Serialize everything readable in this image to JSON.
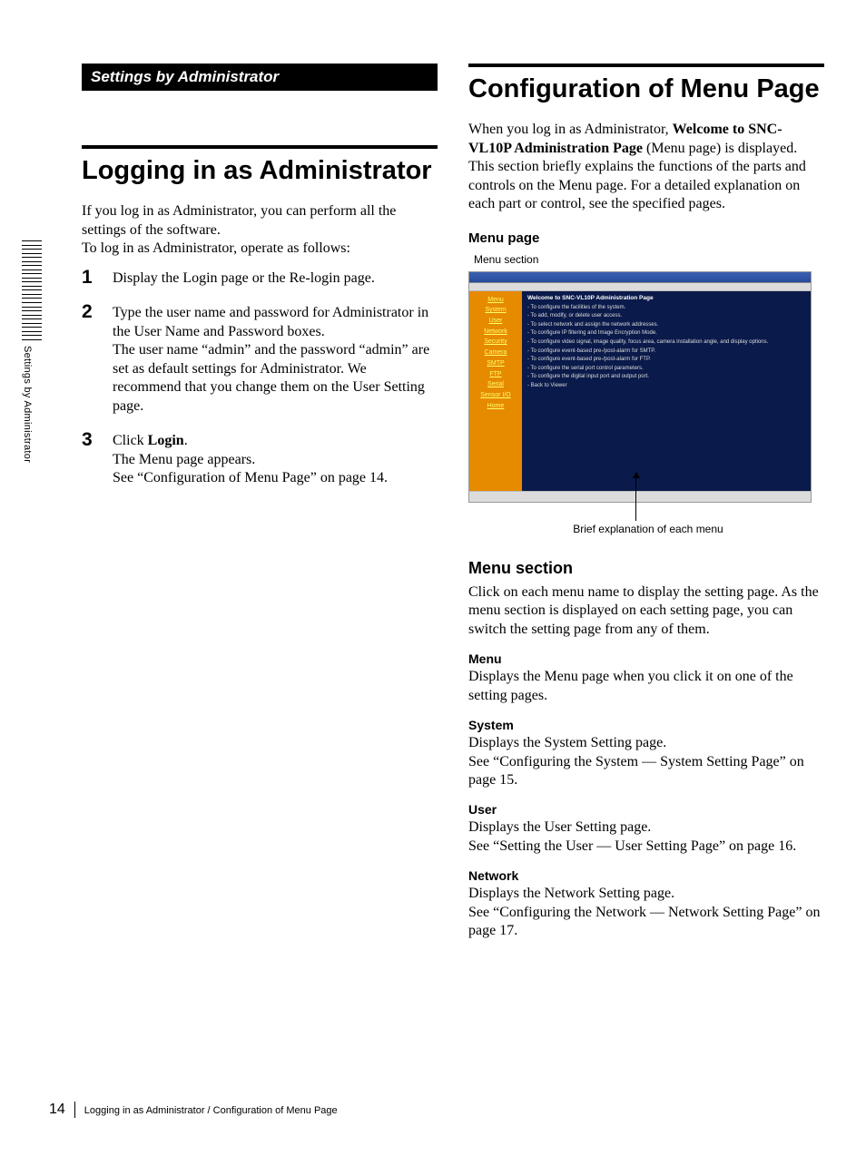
{
  "side_label": "Settings by Administrator",
  "banner": "Settings by Administrator",
  "left": {
    "h1": "Logging in as Administrator",
    "intro1": "If you log in as Administrator, you can perform all the settings of the software.",
    "intro2": "To log in as Administrator, operate as follows:",
    "step1": "Display the Login page or the Re-login page.",
    "step2a": "Type the user name and password for Administrator in the User Name and Password boxes.",
    "step2b": "The user name “admin”  and the password “admin” are set as default settings for Administrator.  We recommend that you change them on the User Setting page.",
    "step3_pre": "Click ",
    "step3_bold": "Login",
    "step3_post": ".",
    "step3b": "The Menu page appears.",
    "step3c": "See “Configuration of Menu Page” on page 14."
  },
  "right": {
    "h1": "Configuration of Menu Page",
    "p1_pre": "When you log in as Administrator, ",
    "p1_bold": "Welcome to SNC-VL10P Administration Page",
    "p1_post": " (Menu page) is displayed.",
    "p2": "This section briefly explains the functions of the parts and controls on the Menu page.  For a detailed explanation on each part or control, see the specified pages.",
    "h_menu_page": "Menu page",
    "cap_top": "Menu section",
    "cap_bottom": "Brief explanation of each menu",
    "shot": {
      "header": "Welcome to SNC-VL10P Administration Page",
      "items": [
        "Menu",
        "System",
        "User",
        "Network",
        "Security",
        "Camera",
        "SMTP",
        "FTP",
        "Serial",
        "Sensor I/O",
        "Home"
      ],
      "descs": [
        "- To configure the facilities of the system.",
        "- To add, modify, or delete user access.",
        "- To select network and assign the network addresses.",
        "- To configure IP filtering and Image Encryption Mode.",
        "- To configure video signal, image quality, focus area, camera installation angle, and display options.",
        "- To configure event-based pre-/post-alarm for SMTP.",
        "- To configure event-based pre-/post-alarm for FTP.",
        "- To configure the serial port control parameters.",
        "- To configure the digital input port and output port.",
        "- Back to Viewer"
      ]
    },
    "h_menu_section": "Menu section",
    "ms_p": "Click on each menu name to display the setting page. As the menu section is displayed on each setting page, you can switch the setting page from any of them.",
    "item_menu_h": "Menu",
    "item_menu_p": "Displays the Menu page when you click it on one of the setting pages.",
    "item_system_h": "System",
    "item_system_p1": "Displays the System Setting page.",
    "item_system_p2": "See “Configuring the System — System Setting Page” on page 15.",
    "item_user_h": "User",
    "item_user_p1": "Displays the User Setting page.",
    "item_user_p2": "See “Setting the User — User Setting Page” on page 16.",
    "item_network_h": "Network",
    "item_network_p1": "Displays the Network Setting page.",
    "item_network_p2": "See “Configuring the Network — Network Setting Page” on page 17."
  },
  "footer": {
    "page": "14",
    "text": "Logging in as Administrator / Configuration of Menu Page"
  }
}
